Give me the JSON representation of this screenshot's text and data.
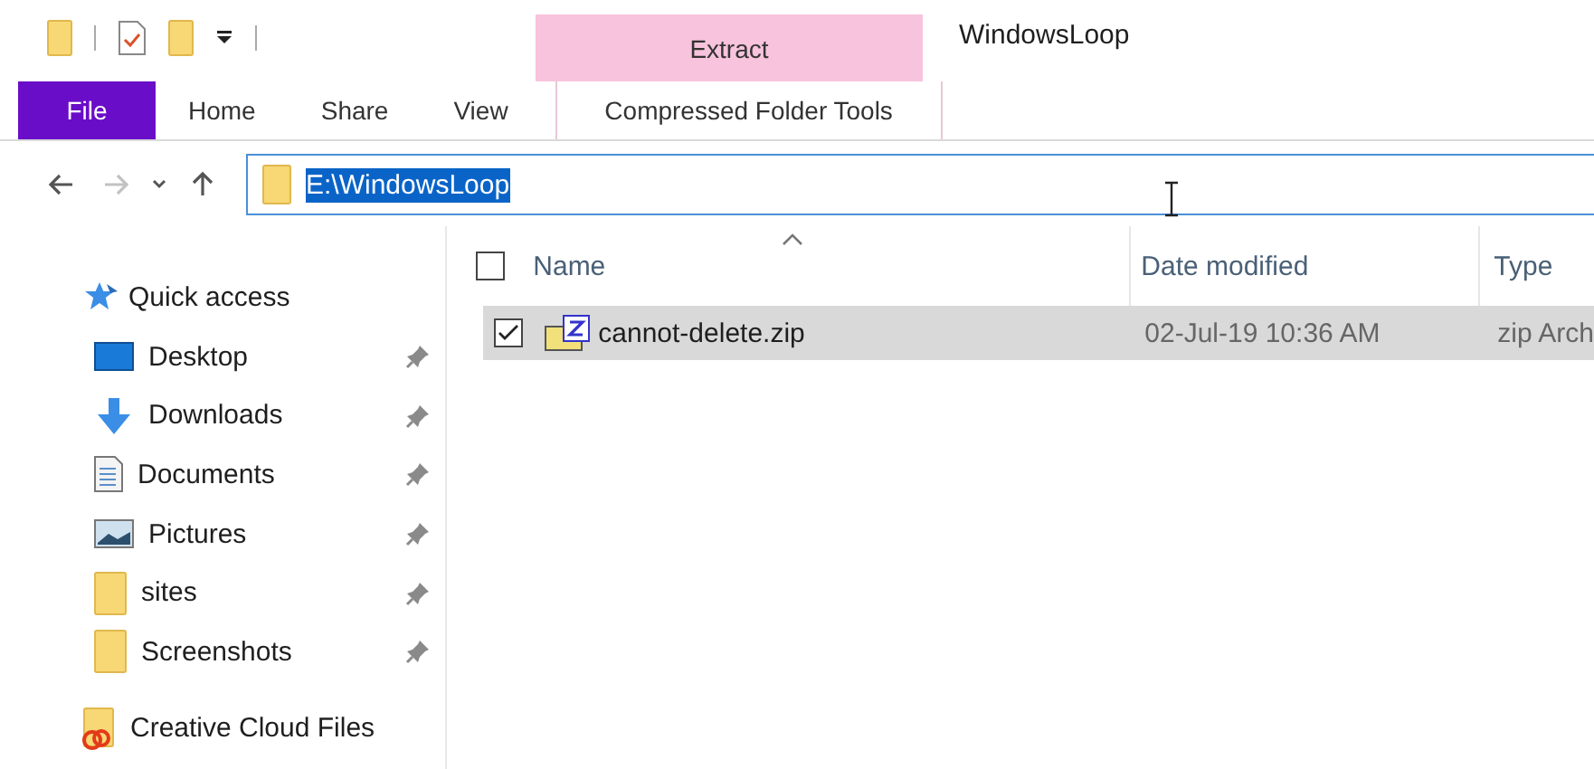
{
  "window": {
    "title": "WindowsLoop"
  },
  "context_tab": {
    "label": "Extract"
  },
  "ribbon_tabs": [
    {
      "label": "File",
      "kind": "file",
      "selected": false
    },
    {
      "label": "Home",
      "kind": "tab",
      "selected": false
    },
    {
      "label": "Share",
      "kind": "tab",
      "selected": false
    },
    {
      "label": "View",
      "kind": "tab",
      "selected": false
    },
    {
      "label": "Compressed Folder Tools",
      "kind": "contextual",
      "selected": false
    }
  ],
  "nav_buttons": [
    {
      "kind": "back",
      "disabled": false
    },
    {
      "kind": "forward",
      "disabled": true
    },
    {
      "kind": "recent",
      "disabled": false
    },
    {
      "kind": "up",
      "disabled": false
    }
  ],
  "address_bar": {
    "value": "E:\\WindowsLoop",
    "selected": true
  },
  "sidebar": {
    "header": {
      "label": "Quick access"
    },
    "items": [
      {
        "label": "Desktop",
        "kind": "desktop",
        "pinned": true
      },
      {
        "label": "Downloads",
        "kind": "downloads",
        "pinned": true
      },
      {
        "label": "Documents",
        "kind": "documents",
        "pinned": true
      },
      {
        "label": "Pictures",
        "kind": "pictures",
        "pinned": true
      },
      {
        "label": "sites",
        "kind": "folder",
        "pinned": true
      },
      {
        "label": "Screenshots",
        "kind": "folder",
        "pinned": true
      }
    ],
    "footer": {
      "label": "Creative Cloud Files"
    }
  },
  "table": {
    "select_all": {
      "checked": false
    },
    "columns": [
      {
        "label": "Name",
        "sorted": true
      },
      {
        "label": "Date modified",
        "sorted": false
      },
      {
        "label": "Type",
        "sorted": false
      }
    ],
    "rows": [
      {
        "name": "cannot-delete.zip",
        "date": "02-Jul-19 10:36 AM",
        "type": "zip Arch",
        "checked": true,
        "selected": true
      }
    ]
  }
}
